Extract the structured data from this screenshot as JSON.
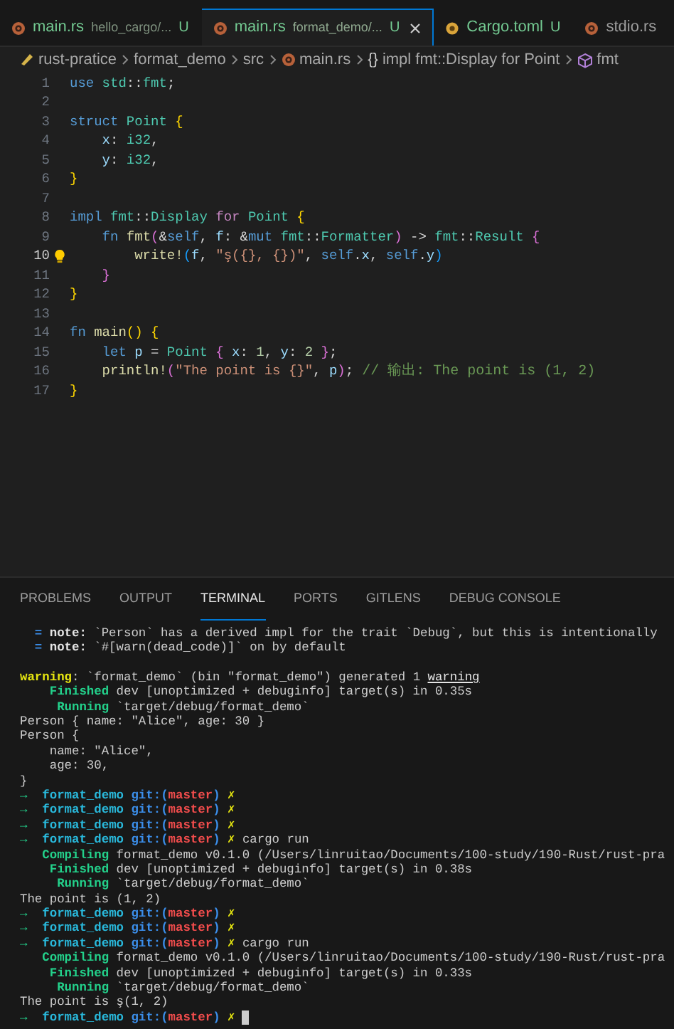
{
  "tabs": [
    {
      "kind": "rust",
      "label": "main.rs",
      "description": "hello_cargo/...",
      "badge": "U",
      "selected": false,
      "closable": false
    },
    {
      "kind": "rust",
      "label": "main.rs",
      "description": "format_demo/...",
      "badge": "U",
      "selected": true,
      "closable": true
    },
    {
      "kind": "toml",
      "label": "Cargo.toml",
      "badge": "U",
      "selected": false,
      "closable": false
    },
    {
      "kind": "rust",
      "label": "stdio.rs",
      "selected": false,
      "closable": false
    }
  ],
  "breadcrumb": [
    {
      "kind": "folder",
      "label": "rust-pratice"
    },
    {
      "kind": "plain",
      "label": "format_demo"
    },
    {
      "kind": "plain",
      "label": "src"
    },
    {
      "kind": "rust",
      "label": "main.rs"
    },
    {
      "kind": "symbol",
      "symbol": "{}",
      "label": "impl fmt::Display for Point"
    },
    {
      "kind": "method",
      "label": "fmt"
    }
  ],
  "code_lines": [
    {
      "number": "1",
      "active": false,
      "segments": [
        {
          "kind": "kw",
          "text": "use"
        },
        {
          "kind": "ns",
          "text": " std"
        },
        {
          "kind": "p",
          "text": "::"
        },
        {
          "kind": "ns",
          "text": "fmt"
        },
        {
          "kind": "p",
          "text": ";"
        }
      ]
    },
    {
      "number": "2",
      "active": false
    },
    {
      "number": "3",
      "active": false,
      "segments": [
        {
          "kind": "kw",
          "text": "struct"
        },
        {
          "kind": "type",
          "text": " Point"
        },
        {
          "kind": "b1",
          "text": " {"
        }
      ]
    },
    {
      "number": "4",
      "active": false,
      "segments": [
        {
          "kind": "field",
          "text": "    x"
        },
        {
          "kind": "p",
          "text": ": "
        },
        {
          "kind": "type",
          "text": "i32"
        },
        {
          "kind": "p",
          "text": ","
        }
      ]
    },
    {
      "number": "5",
      "active": false,
      "segments": [
        {
          "kind": "field",
          "text": "    y"
        },
        {
          "kind": "p",
          "text": ": "
        },
        {
          "kind": "type",
          "text": "i32"
        },
        {
          "kind": "p",
          "text": ","
        }
      ]
    },
    {
      "number": "6",
      "active": false,
      "segments": [
        {
          "kind": "b1",
          "text": "}"
        }
      ]
    },
    {
      "number": "7",
      "active": false
    },
    {
      "number": "8",
      "active": false,
      "segments": [
        {
          "kind": "kw",
          "text": "impl"
        },
        {
          "kind": "ns",
          "text": " fmt"
        },
        {
          "kind": "p",
          "text": "::"
        },
        {
          "kind": "type",
          "text": "Display"
        },
        {
          "kind": "kw2",
          "text": " for"
        },
        {
          "kind": "type",
          "text": " Point"
        },
        {
          "kind": "b1",
          "text": " {"
        }
      ]
    },
    {
      "number": "9",
      "active": false,
      "segments": [
        {
          "kind": "kw",
          "text": "    fn"
        },
        {
          "kind": "fn",
          "text": " fmt"
        },
        {
          "kind": "b2",
          "text": "("
        },
        {
          "kind": "p",
          "text": "&"
        },
        {
          "kind": "kw",
          "text": "self"
        },
        {
          "kind": "p",
          "text": ","
        },
        {
          "kind": "field",
          "text": " f"
        },
        {
          "kind": "p",
          "text": ": &"
        },
        {
          "kind": "kw",
          "text": "mut"
        },
        {
          "kind": "ns",
          "text": " fmt"
        },
        {
          "kind": "p",
          "text": "::"
        },
        {
          "kind": "type",
          "text": "Formatter"
        },
        {
          "kind": "b2",
          "text": ")"
        },
        {
          "kind": "p",
          "text": " ->"
        },
        {
          "kind": "ns",
          "text": " fmt"
        },
        {
          "kind": "p",
          "text": "::"
        },
        {
          "kind": "type",
          "text": "Result"
        },
        {
          "kind": "b2",
          "text": " {"
        }
      ]
    },
    {
      "number": "10",
      "active": true,
      "lightbulb": true,
      "segments": [
        {
          "kind": "fn",
          "text": "        write!"
        },
        {
          "kind": "b3",
          "text": "("
        },
        {
          "kind": "field",
          "text": "f"
        },
        {
          "kind": "p",
          "text": ","
        },
        {
          "kind": "str",
          "text": " \"ş({}, {})\""
        },
        {
          "kind": "p",
          "text": ","
        },
        {
          "kind": "kw",
          "text": " self"
        },
        {
          "kind": "p",
          "text": "."
        },
        {
          "kind": "field",
          "text": "x"
        },
        {
          "kind": "p",
          "text": ","
        },
        {
          "kind": "kw",
          "text": " self"
        },
        {
          "kind": "p",
          "text": "."
        },
        {
          "kind": "field",
          "text": "y"
        },
        {
          "kind": "b3",
          "text": ")"
        }
      ]
    },
    {
      "number": "11",
      "active": false,
      "segments": [
        {
          "kind": "b2",
          "text": "    }"
        }
      ]
    },
    {
      "number": "12",
      "active": false,
      "segments": [
        {
          "kind": "b1",
          "text": "}"
        }
      ]
    },
    {
      "number": "13",
      "active": false
    },
    {
      "number": "14",
      "active": false,
      "segments": [
        {
          "kind": "kw",
          "text": "fn"
        },
        {
          "kind": "fn",
          "text": " main"
        },
        {
          "kind": "b1",
          "text": "()"
        },
        {
          "kind": "b1",
          "text": " {"
        }
      ]
    },
    {
      "number": "15",
      "active": false,
      "segments": [
        {
          "kind": "kw",
          "text": "    let"
        },
        {
          "kind": "field",
          "text": " p"
        },
        {
          "kind": "p",
          "text": " ="
        },
        {
          "kind": "type",
          "text": " Point"
        },
        {
          "kind": "b2",
          "text": " {"
        },
        {
          "kind": "field",
          "text": " x"
        },
        {
          "kind": "p",
          "text": ":"
        },
        {
          "kind": "num",
          "text": " 1"
        },
        {
          "kind": "p",
          "text": ","
        },
        {
          "kind": "field",
          "text": " y"
        },
        {
          "kind": "p",
          "text": ":"
        },
        {
          "kind": "num",
          "text": " 2"
        },
        {
          "kind": "b2",
          "text": " }"
        },
        {
          "kind": "p",
          "text": ";"
        }
      ]
    },
    {
      "number": "16",
      "active": false,
      "segments": [
        {
          "kind": "fn",
          "text": "    println!"
        },
        {
          "kind": "b2",
          "text": "("
        },
        {
          "kind": "str",
          "text": "\"The point is {}\""
        },
        {
          "kind": "p",
          "text": ","
        },
        {
          "kind": "field",
          "text": " p"
        },
        {
          "kind": "b2",
          "text": ")"
        },
        {
          "kind": "p",
          "text": ";"
        },
        {
          "kind": "comment",
          "text": " // 输出: The point is (1, 2)"
        }
      ]
    },
    {
      "number": "17",
      "active": false,
      "segments": [
        {
          "kind": "b1",
          "text": "}"
        }
      ]
    }
  ],
  "panel_tabs": [
    {
      "label": "PROBLEMS",
      "selected": false
    },
    {
      "label": "OUTPUT",
      "selected": false
    },
    {
      "label": "TERMINAL",
      "selected": true
    },
    {
      "label": "PORTS",
      "selected": false
    },
    {
      "label": "GITLENS",
      "selected": false
    },
    {
      "label": "DEBUG CONSOLE",
      "selected": false
    }
  ],
  "terminal_lines": [
    {
      "segments": [
        {
          "kind": "eq",
          "text": "  ="
        },
        {
          "kind": "bold",
          "text": " note:"
        },
        {
          "kind": "plain",
          "text": " `Person` has a derived impl for the trait `Debug`, but this is intentionally"
        }
      ]
    },
    {
      "segments": [
        {
          "kind": "eq",
          "text": "  ="
        },
        {
          "kind": "bold",
          "text": " note:"
        },
        {
          "kind": "plain",
          "text": " `#[warn(dead_code)]` on by default"
        }
      ]
    },
    {
      "blank": true
    },
    {
      "segments": [
        {
          "kind": "warn",
          "text": "warning"
        },
        {
          "kind": "plain",
          "text": ": `format_demo` (bin \"format_demo\") generated 1 "
        },
        {
          "kind": "underline",
          "text": "warning"
        }
      ]
    },
    {
      "segments": [
        {
          "kind": "ok",
          "text": "    Finished"
        },
        {
          "kind": "plain",
          "text": " dev [unoptimized + debuginfo] target(s) in 0.35s"
        }
      ]
    },
    {
      "segments": [
        {
          "kind": "ok",
          "text": "     Running"
        },
        {
          "kind": "plain",
          "text": " `target/debug/format_demo`"
        }
      ]
    },
    {
      "segments": [
        {
          "kind": "plain",
          "text": "Person { name: \"Alice\", age: 30 }"
        }
      ]
    },
    {
      "segments": [
        {
          "kind": "plain",
          "text": "Person {"
        }
      ]
    },
    {
      "segments": [
        {
          "kind": "plain",
          "text": "    name: \"Alice\","
        }
      ]
    },
    {
      "segments": [
        {
          "kind": "plain",
          "text": "    age: 30,"
        }
      ]
    },
    {
      "segments": [
        {
          "kind": "plain",
          "text": "}"
        }
      ]
    },
    {
      "segments": [
        {
          "kind": "arrow",
          "text": "→"
        },
        {
          "kind": "dir",
          "text": "  format_demo"
        },
        {
          "kind": "git",
          "text": " git:("
        },
        {
          "kind": "branch",
          "text": "master"
        },
        {
          "kind": "git",
          "text": ")"
        },
        {
          "kind": "x",
          "text": " ✗"
        }
      ]
    },
    {
      "segments": [
        {
          "kind": "arrow",
          "text": "→"
        },
        {
          "kind": "dir",
          "text": "  format_demo"
        },
        {
          "kind": "git",
          "text": " git:("
        },
        {
          "kind": "branch",
          "text": "master"
        },
        {
          "kind": "git",
          "text": ")"
        },
        {
          "kind": "x",
          "text": " ✗"
        }
      ]
    },
    {
      "segments": [
        {
          "kind": "arrow",
          "text": "→"
        },
        {
          "kind": "dir",
          "text": "  format_demo"
        },
        {
          "kind": "git",
          "text": " git:("
        },
        {
          "kind": "branch",
          "text": "master"
        },
        {
          "kind": "git",
          "text": ")"
        },
        {
          "kind": "x",
          "text": " ✗"
        }
      ]
    },
    {
      "segments": [
        {
          "kind": "arrow",
          "text": "→"
        },
        {
          "kind": "dir",
          "text": "  format_demo"
        },
        {
          "kind": "git",
          "text": " git:("
        },
        {
          "kind": "branch",
          "text": "master"
        },
        {
          "kind": "git",
          "text": ")"
        },
        {
          "kind": "x",
          "text": " ✗"
        },
        {
          "kind": "plain",
          "text": " cargo run"
        }
      ]
    },
    {
      "segments": [
        {
          "kind": "ok",
          "text": "   Compiling"
        },
        {
          "kind": "plain",
          "text": " format_demo v0.1.0 (/Users/linruitao/Documents/100-study/190-Rust/rust-pra"
        }
      ]
    },
    {
      "segments": [
        {
          "kind": "ok",
          "text": "    Finished"
        },
        {
          "kind": "plain",
          "text": " dev [unoptimized + debuginfo] target(s) in 0.38s"
        }
      ]
    },
    {
      "segments": [
        {
          "kind": "ok",
          "text": "     Running"
        },
        {
          "kind": "plain",
          "text": " `target/debug/format_demo`"
        }
      ]
    },
    {
      "segments": [
        {
          "kind": "plain",
          "text": "The point is (1, 2)"
        }
      ]
    },
    {
      "segments": [
        {
          "kind": "arrow",
          "text": "→"
        },
        {
          "kind": "dir",
          "text": "  format_demo"
        },
        {
          "kind": "git",
          "text": " git:("
        },
        {
          "kind": "branch",
          "text": "master"
        },
        {
          "kind": "git",
          "text": ")"
        },
        {
          "kind": "x",
          "text": " ✗"
        }
      ]
    },
    {
      "segments": [
        {
          "kind": "arrow",
          "text": "→"
        },
        {
          "kind": "dir",
          "text": "  format_demo"
        },
        {
          "kind": "git",
          "text": " git:("
        },
        {
          "kind": "branch",
          "text": "master"
        },
        {
          "kind": "git",
          "text": ")"
        },
        {
          "kind": "x",
          "text": " ✗"
        }
      ]
    },
    {
      "segments": [
        {
          "kind": "arrow",
          "text": "→"
        },
        {
          "kind": "dir",
          "text": "  format_demo"
        },
        {
          "kind": "git",
          "text": " git:("
        },
        {
          "kind": "branch",
          "text": "master"
        },
        {
          "kind": "git",
          "text": ")"
        },
        {
          "kind": "x",
          "text": " ✗"
        },
        {
          "kind": "plain",
          "text": " cargo run"
        }
      ]
    },
    {
      "segments": [
        {
          "kind": "ok",
          "text": "   Compiling"
        },
        {
          "kind": "plain",
          "text": " format_demo v0.1.0 (/Users/linruitao/Documents/100-study/190-Rust/rust-pra"
        }
      ]
    },
    {
      "segments": [
        {
          "kind": "ok",
          "text": "    Finished"
        },
        {
          "kind": "plain",
          "text": " dev [unoptimized + debuginfo] target(s) in 0.33s"
        }
      ]
    },
    {
      "segments": [
        {
          "kind": "ok",
          "text": "     Running"
        },
        {
          "kind": "plain",
          "text": " `target/debug/format_demo`"
        }
      ]
    },
    {
      "segments": [
        {
          "kind": "plain",
          "text": "The point is ş(1, 2)"
        }
      ]
    },
    {
      "cursor": true,
      "segments": [
        {
          "kind": "arrow",
          "text": "→"
        },
        {
          "kind": "dir",
          "text": "  format_demo"
        },
        {
          "kind": "git",
          "text": " git:("
        },
        {
          "kind": "branch",
          "text": "master"
        },
        {
          "kind": "git",
          "text": ")"
        },
        {
          "kind": "x",
          "text": " ✗"
        }
      ]
    }
  ]
}
